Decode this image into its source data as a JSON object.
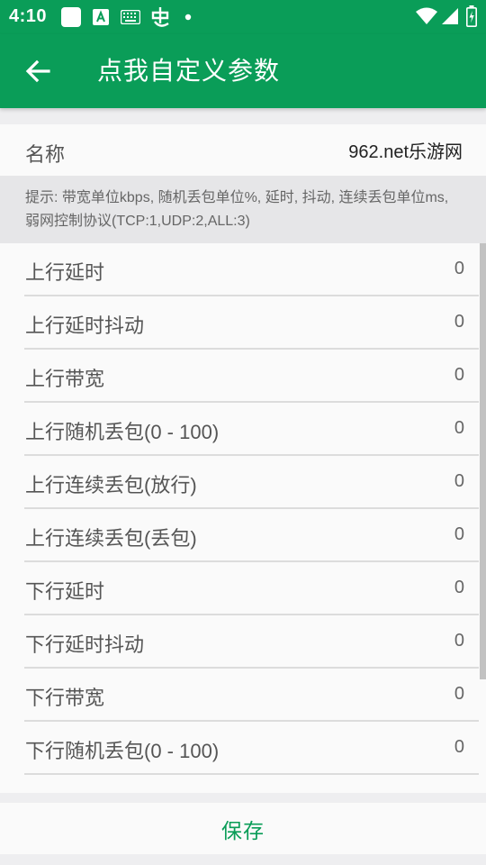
{
  "status_bar": {
    "time": "4:10",
    "icons": [
      "notification-square-icon",
      "a-box-icon",
      "keyboard-icon",
      "bug-icon",
      "dot-icon",
      "wifi-icon",
      "signal-icon",
      "battery-icon"
    ]
  },
  "app_bar": {
    "back_icon": "arrow-back-icon",
    "title": "点我自定义参数",
    "color": "#0a9d58"
  },
  "name_row": {
    "label": "名称",
    "value": "962.net乐游网"
  },
  "hint": {
    "text": "提示: 带宽单位kbps, 随机丢包单位%, 延时, 抖动, 连续丢包单位ms, 弱网控制协议(TCP:1,UDP:2,ALL:3)"
  },
  "params": [
    {
      "label": "上行延时",
      "value": "0"
    },
    {
      "label": "上行延时抖动",
      "value": "0"
    },
    {
      "label": "上行带宽",
      "value": "0"
    },
    {
      "label": "上行随机丢包(0 - 100)",
      "value": "0"
    },
    {
      "label": "上行连续丢包(放行)",
      "value": "0"
    },
    {
      "label": "上行连续丢包(丢包)",
      "value": "0"
    },
    {
      "label": "下行延时",
      "value": "0"
    },
    {
      "label": "下行延时抖动",
      "value": "0"
    },
    {
      "label": "下行带宽",
      "value": "0"
    },
    {
      "label": "下行随机丢包(0 - 100)",
      "value": "0"
    },
    {
      "label": "",
      "value": ""
    }
  ],
  "save": {
    "label": "保存"
  }
}
